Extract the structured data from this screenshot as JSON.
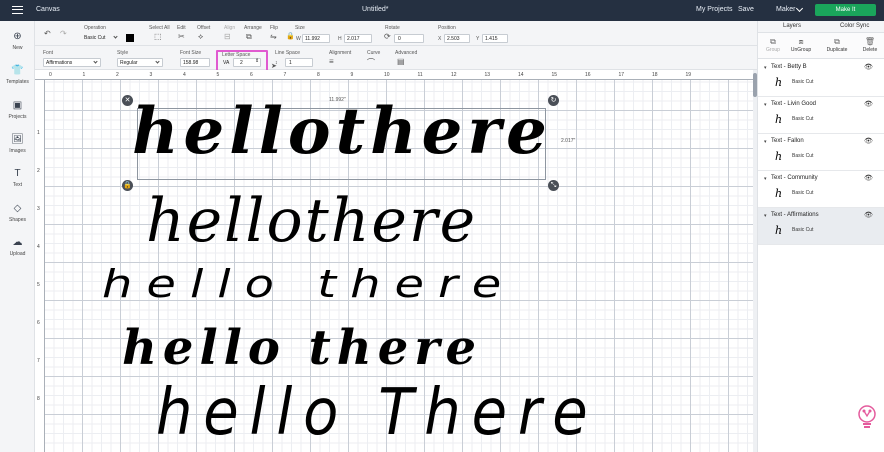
{
  "titlebar": {
    "app_name": "Canvas",
    "doc_title": "Untitled*",
    "my_projects": "My Projects",
    "save": "Save",
    "machine": "Maker",
    "make_it": "Make It"
  },
  "toolbar1": {
    "operation_label": "Operation",
    "operation_value": "Basic Cut",
    "select_all": "Select All",
    "edit": "Edit",
    "offset": "Offset",
    "align": "Align",
    "arrange": "Arrange",
    "flip": "Flip",
    "size_label": "Size",
    "w_label": "W",
    "w_value": "11.992",
    "h_label": "H",
    "h_value": "2.017",
    "rotate_label": "Rotate",
    "rotate_value": "0",
    "position_label": "Position",
    "x_label": "X",
    "x_value": "2.503",
    "y_label": "Y",
    "y_value": "1.415"
  },
  "toolbar2": {
    "font_label": "Font",
    "font_value": "Affirmations",
    "style_label": "Style",
    "style_value": "Regular",
    "font_size_label": "Font Size",
    "font_size_value": "158.98",
    "letter_space_label": "Letter Space",
    "letter_space_value": "2",
    "line_space_label": "Line Space",
    "line_space_value": "1",
    "alignment_label": "Alignment",
    "curve_label": "Curve",
    "advanced_label": "Advanced"
  },
  "leftbar": [
    {
      "label": "New",
      "icon": "plus-circle-icon",
      "glyph": "⊕"
    },
    {
      "label": "Templates",
      "icon": "shirt-icon",
      "glyph": "👕"
    },
    {
      "label": "Projects",
      "icon": "projects-icon",
      "glyph": "▣"
    },
    {
      "label": "Images",
      "icon": "images-icon",
      "glyph": "🖼"
    },
    {
      "label": "Text",
      "icon": "text-icon",
      "glyph": "T"
    },
    {
      "label": "Shapes",
      "icon": "shapes-icon",
      "glyph": "◇"
    },
    {
      "label": "Upload",
      "icon": "upload-icon",
      "glyph": "☁"
    }
  ],
  "ruler": {
    "h": [
      "0",
      "1",
      "2",
      "3",
      "4",
      "5",
      "6",
      "7",
      "8",
      "9",
      "10",
      "11",
      "12",
      "13",
      "14",
      "15",
      "16",
      "17",
      "18",
      "19"
    ],
    "v": [
      "1",
      "2",
      "3",
      "4",
      "5",
      "6",
      "7",
      "8"
    ]
  },
  "canvas": {
    "width_dim": "11.992\"",
    "height_dim": "2.017\"",
    "texts": [
      "hellothere",
      "hellothere",
      "hello there",
      "hello there",
      "hello There"
    ]
  },
  "rightpanel": {
    "tab_layers": "Layers",
    "tab_color_sync": "Color Sync",
    "actions": [
      "Group",
      "UnGroup",
      "Duplicate",
      "Delete"
    ],
    "layers": [
      {
        "name": "Text - Betty B",
        "cut": "Basic Cut",
        "thumb": "h"
      },
      {
        "name": "Text - Livin Good",
        "cut": "Basic Cut",
        "thumb": "h"
      },
      {
        "name": "Text - Fallon",
        "cut": "Basic Cut",
        "thumb": "h"
      },
      {
        "name": "Text - Community",
        "cut": "Basic Cut",
        "thumb": "h"
      },
      {
        "name": "Text - Affirmations",
        "cut": "Basic Cut",
        "thumb": "h"
      }
    ]
  },
  "colors": {
    "titlebar_bg": "#253041",
    "make_it_green": "#1aa55b",
    "highlight_pink": "#e05ad0",
    "brand_pink": "#e45b9d"
  }
}
